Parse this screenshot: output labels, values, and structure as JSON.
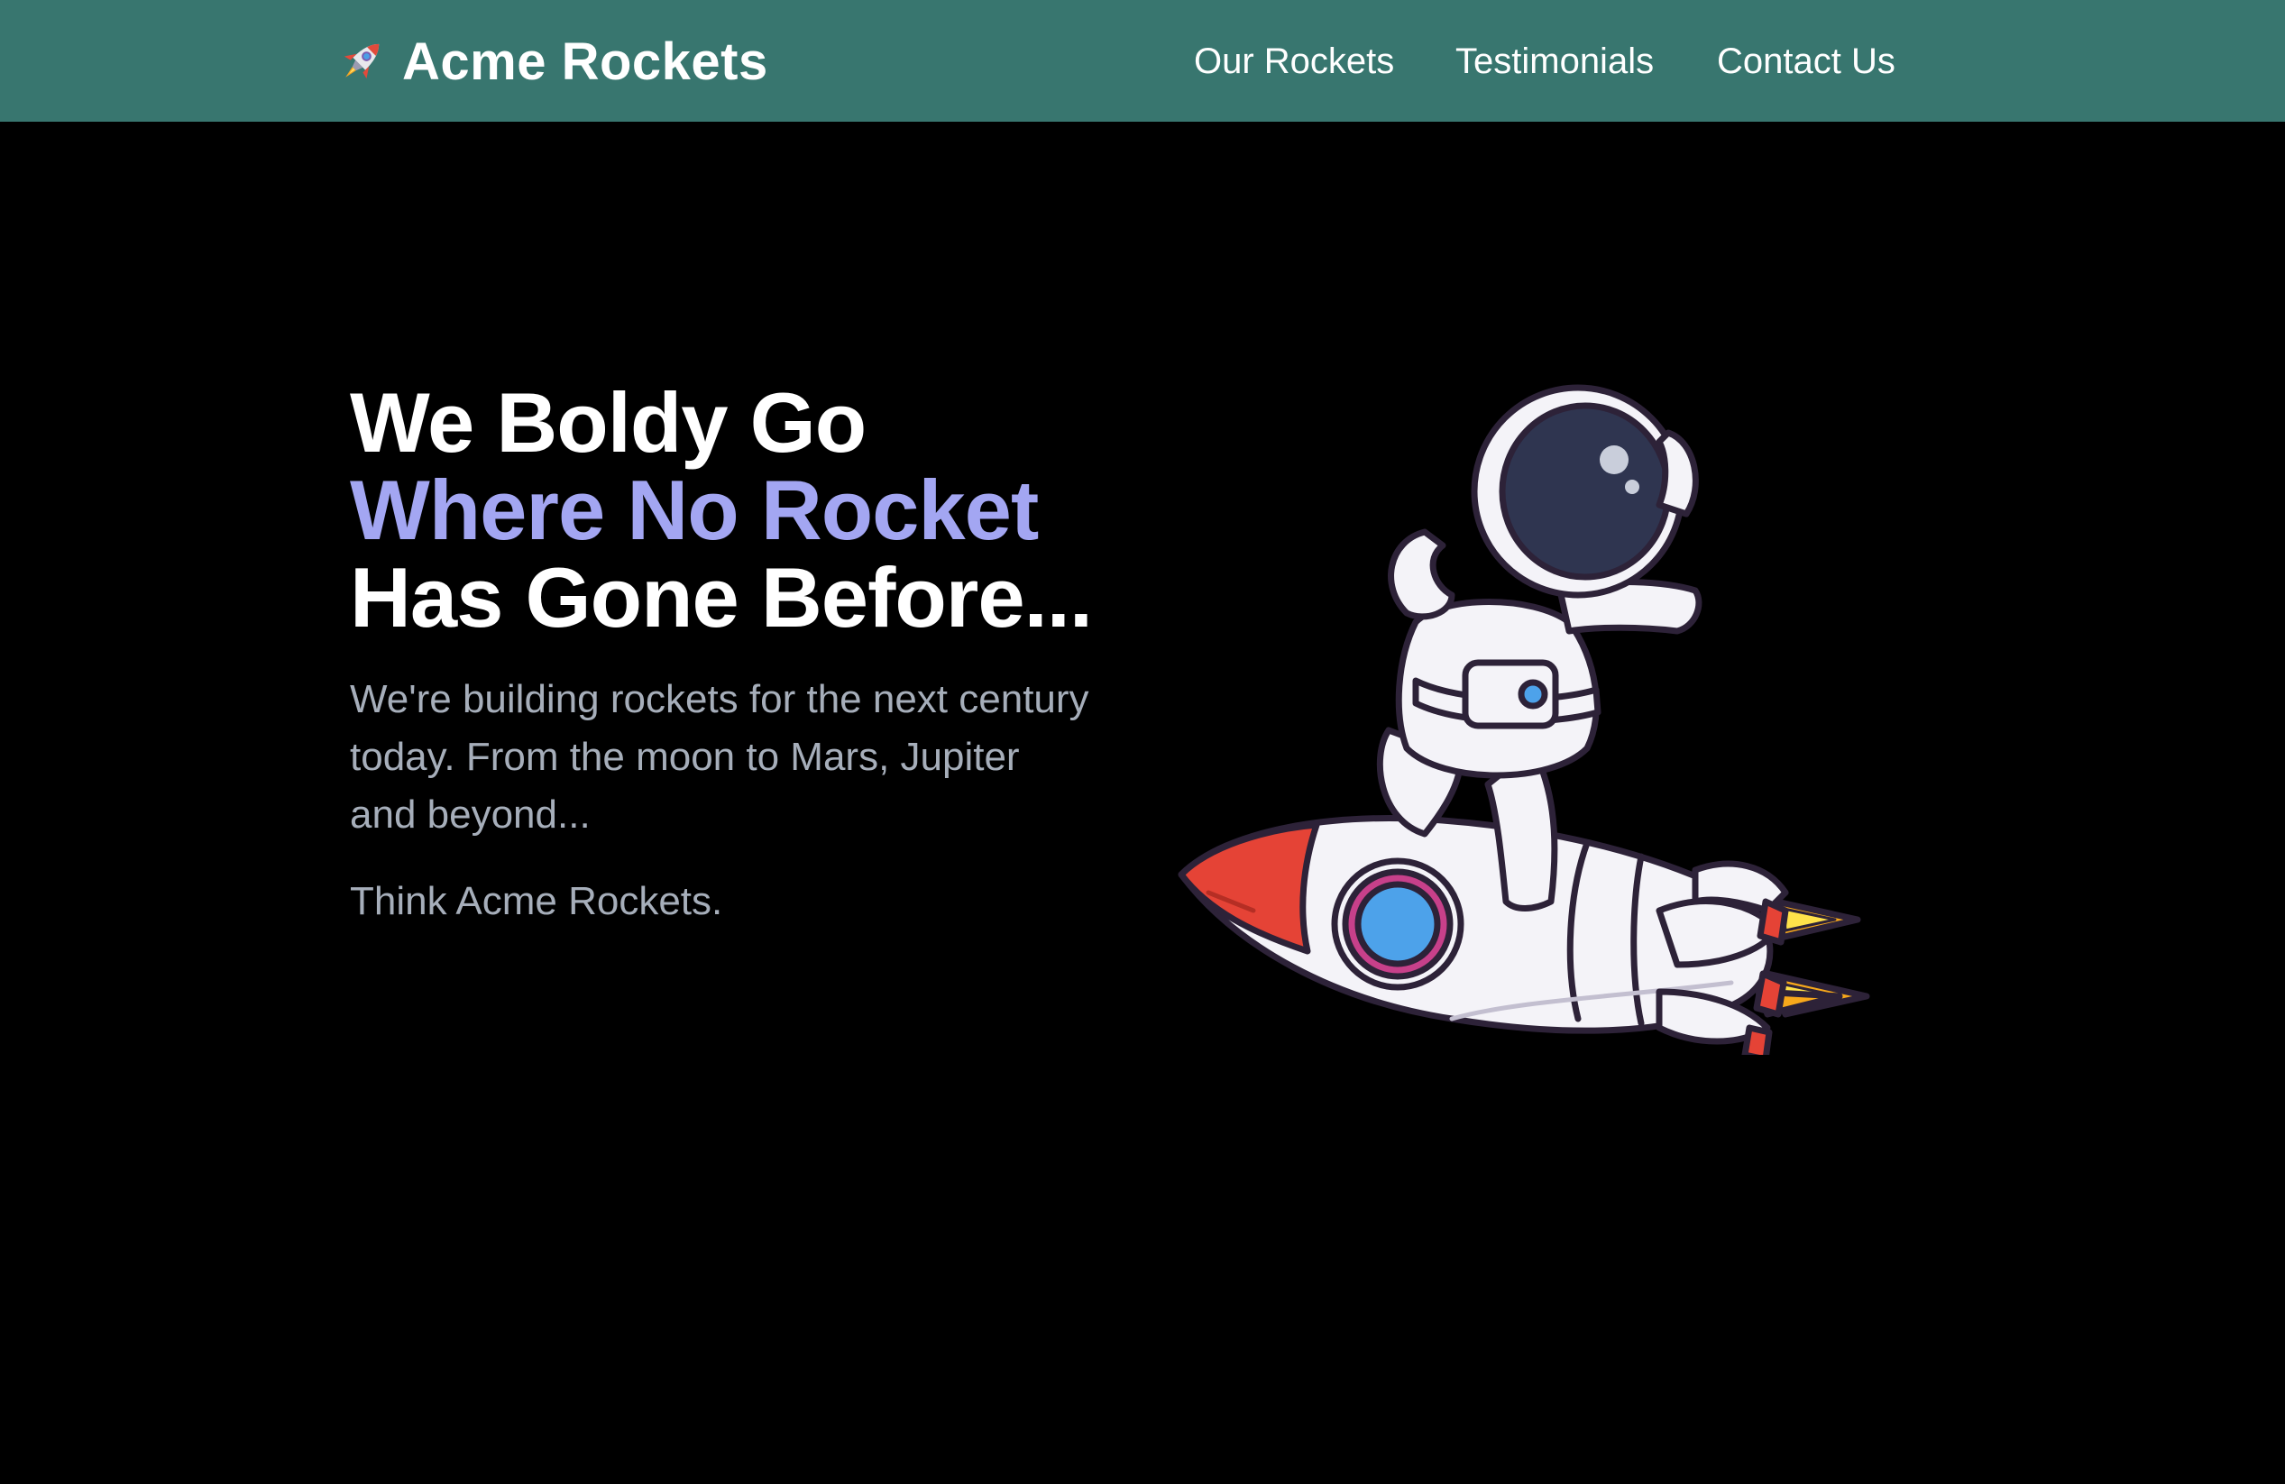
{
  "header": {
    "brand_emoji": "🚀",
    "brand_name": "Acme Rockets",
    "nav": [
      {
        "label": "Our Rockets"
      },
      {
        "label": "Testimonials"
      },
      {
        "label": "Contact Us"
      }
    ]
  },
  "hero": {
    "headline_line1": "We Boldy Go",
    "headline_line2": "Where No Rocket",
    "headline_line3": "Has Gone Before...",
    "lead": "We're building rockets for the next century today. From the moon to Mars, Jupiter and beyond...",
    "tagline": "Think Acme Rockets.",
    "illustration_icon": "astronaut-on-rocket"
  },
  "colors": {
    "header_bg": "#38766f",
    "page_bg": "#000000",
    "accent": "#a3a6f2",
    "muted_text": "#a6aeba"
  }
}
